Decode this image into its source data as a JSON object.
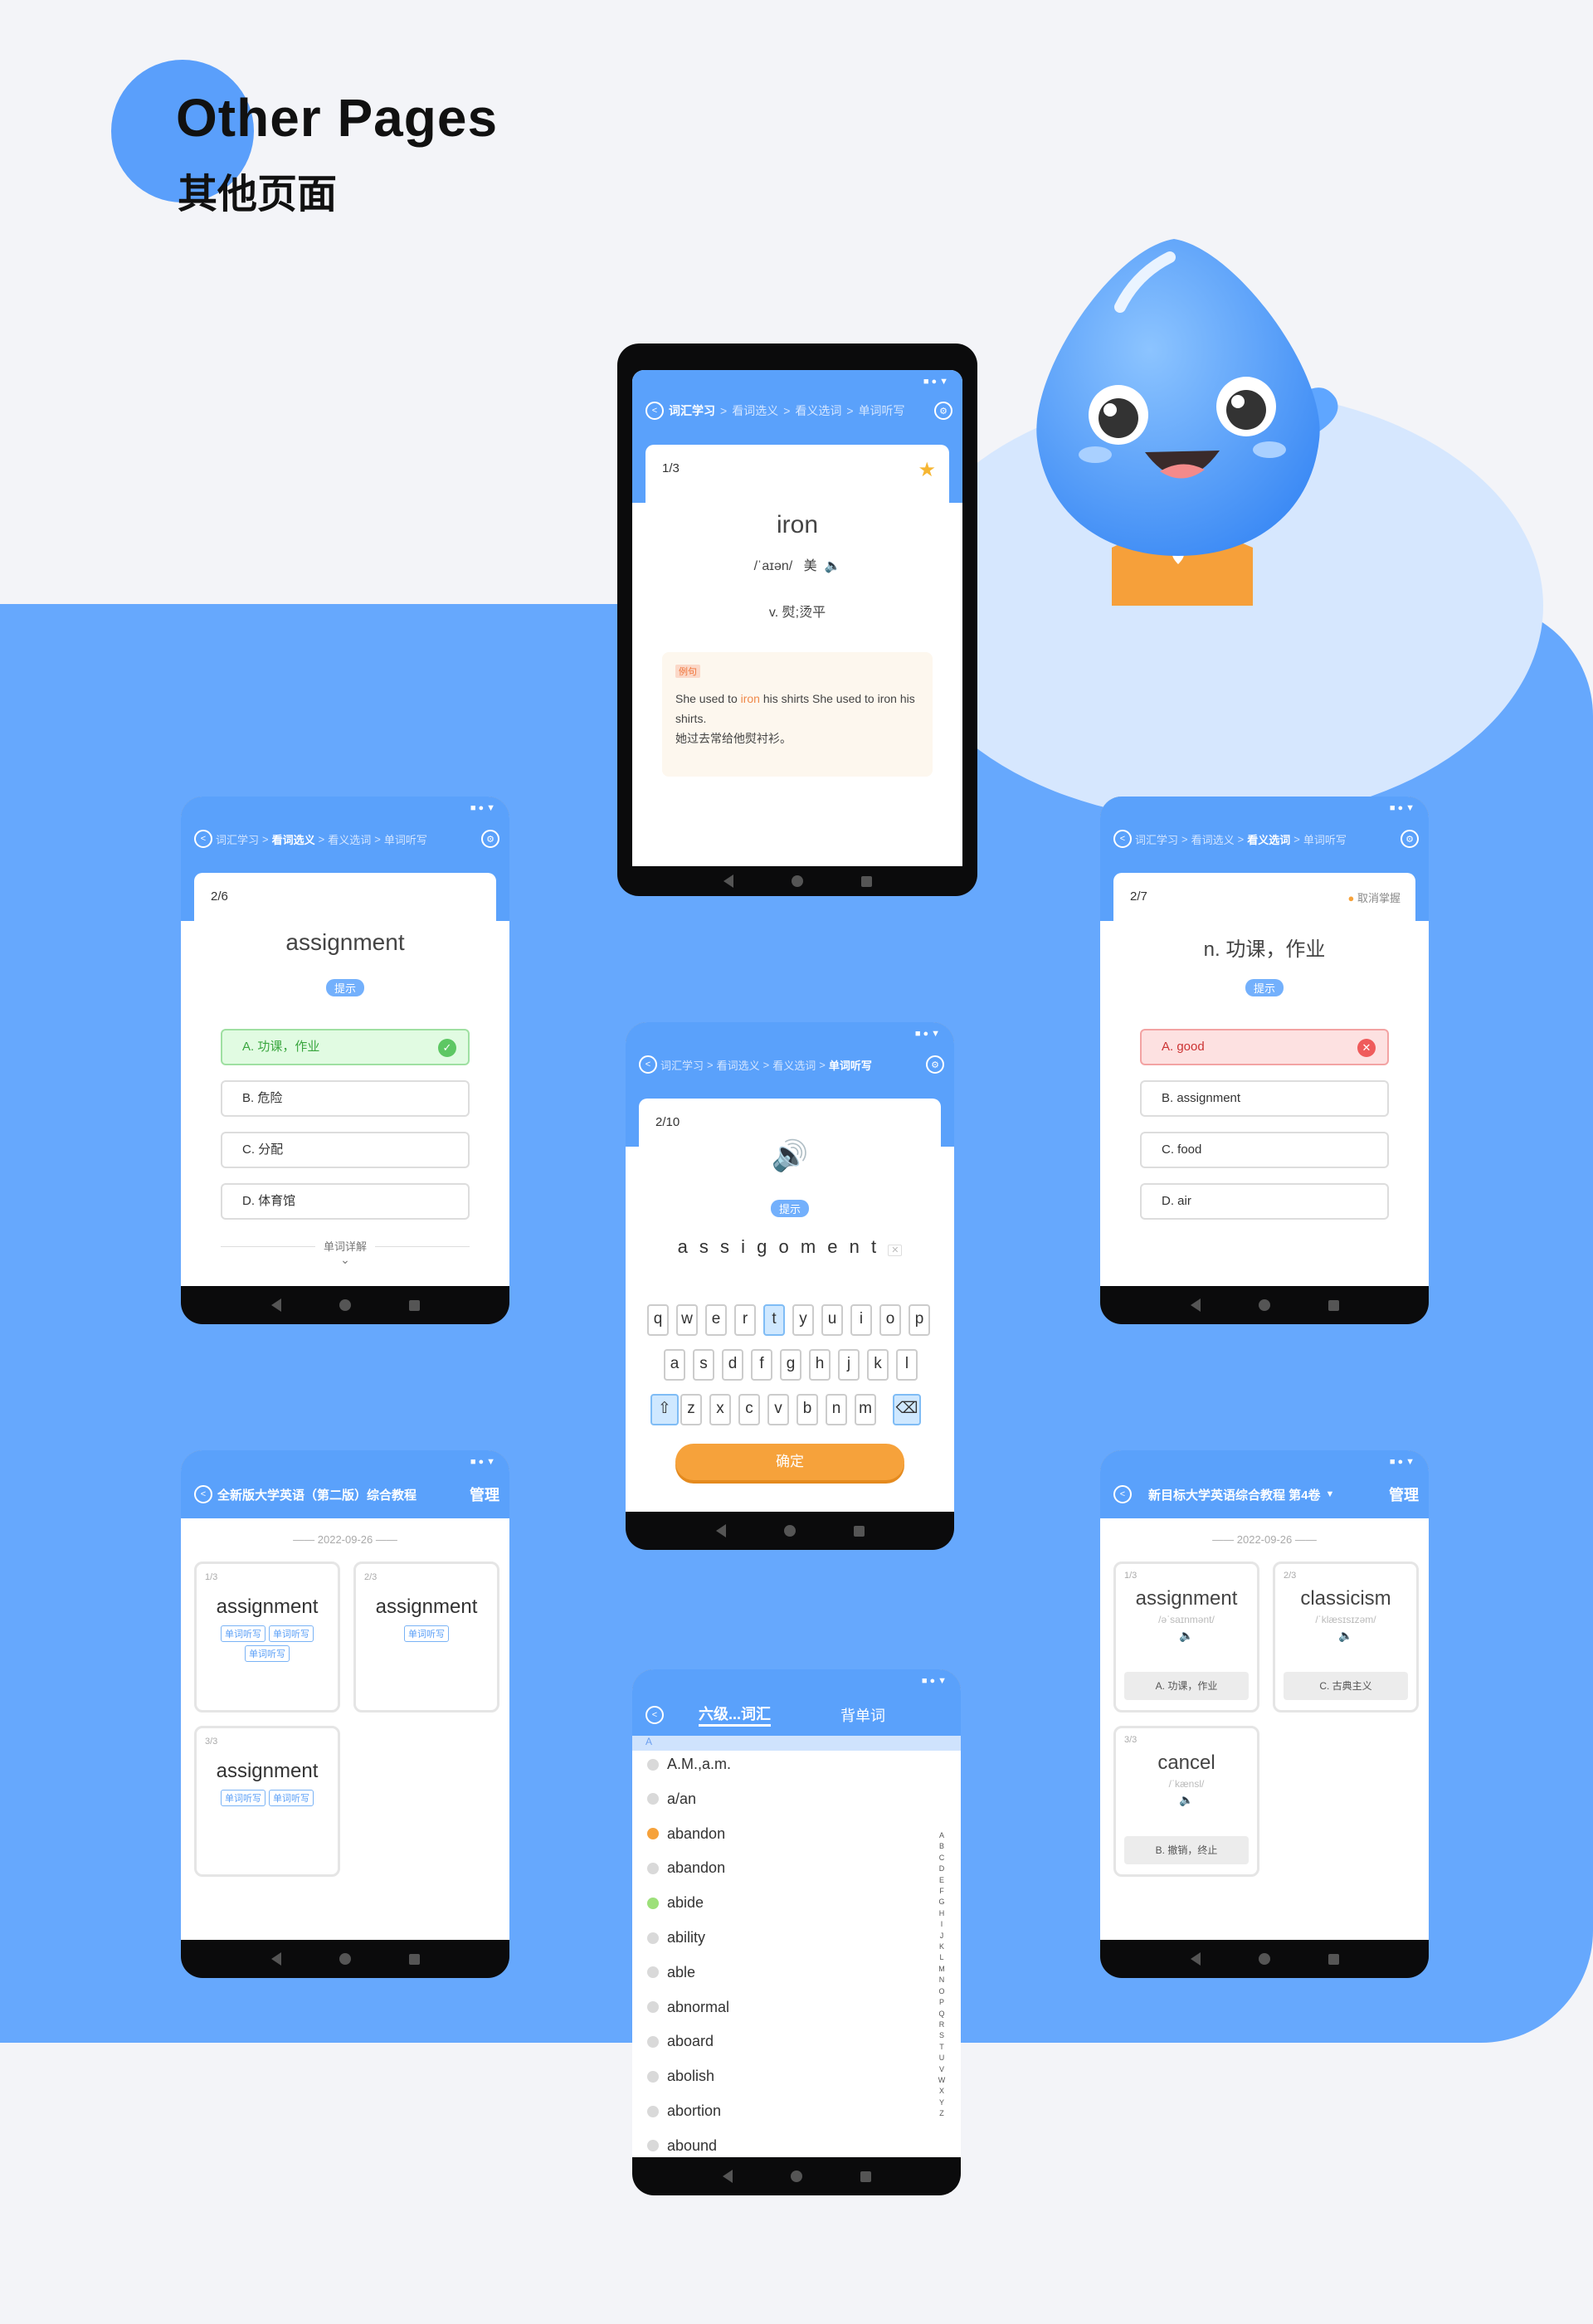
{
  "header": {
    "title_en": "Other Pages",
    "title_cn": "其他页面"
  },
  "status_icons": "■●▼",
  "colors": {
    "primary": "#5aa1fb",
    "panel": "#66a8fd",
    "orange": "#f6a23b",
    "correct": "#5dc763",
    "wrong": "#ef5b5b"
  },
  "p1": {
    "crumbs": [
      "词汇学习",
      "看词选义",
      "看义选词",
      "单词听写"
    ],
    "active": 0,
    "counter": "1/3",
    "word": "iron",
    "phonetic": "/ˈaɪən/",
    "accent": "美",
    "meaning": "v. 熨;烫平",
    "example_label": "例句",
    "example_pre": "She used to ",
    "example_hl": "iron",
    "example_post": " his shirts She used to iron his shirts.",
    "example_cn": "她过去常给他熨衬衫。"
  },
  "p2": {
    "crumbs": [
      "词汇学习",
      "看词选义",
      "看义选词",
      "单词听写"
    ],
    "counter": "2/6",
    "word": "assignment",
    "hint": "提示",
    "options": [
      "A. 功课，作业",
      "B. 危险",
      "C. 分配",
      "D. 体育馆"
    ],
    "detail": "单词详解"
  },
  "p3": {
    "crumbs": [
      "词汇学习",
      "看词选义",
      "看义选词",
      "单词听写"
    ],
    "counter": "2/7",
    "unmaster": "取消掌握",
    "word": "n. 功课，作业",
    "hint": "提示",
    "options": [
      "A. good",
      "B. assignment",
      "C. food",
      "D. air"
    ]
  },
  "p4": {
    "crumbs": [
      "词汇学习",
      "看词选义",
      "看义选词",
      "单词听写"
    ],
    "counter": "2/10",
    "hint": "提示",
    "letters": "a s s i g o m e n t",
    "keys_row1": [
      "q",
      "w",
      "e",
      "r",
      "t",
      "y",
      "u",
      "i",
      "o",
      "p"
    ],
    "keys_row2": [
      "a",
      "s",
      "d",
      "f",
      "g",
      "h",
      "j",
      "k",
      "l"
    ],
    "keys_row3": [
      "z",
      "x",
      "c",
      "v",
      "b",
      "n",
      "m"
    ],
    "confirm": "确定"
  },
  "p5": {
    "title": "全新版大学英语（第二版）综合教程",
    "manage": "管理",
    "date": "2022-09-26",
    "cards": [
      {
        "count": "1/3",
        "word": "assignment",
        "tags": [
          "单词听写",
          "单词听写",
          "单词听写"
        ]
      },
      {
        "count": "2/3",
        "word": "assignment",
        "tags": [
          "单词听写"
        ]
      },
      {
        "count": "3/3",
        "word": "assignment",
        "tags": [
          "单词听写",
          "单词听写"
        ]
      }
    ]
  },
  "p6": {
    "title": "新目标大学英语综合教程 第4卷",
    "manage": "管理",
    "date": "2022-09-26",
    "cards": [
      {
        "count": "1/3",
        "word": "assignment",
        "phon": "/əˈsaɪnmənt/",
        "meaning": "A. 功课，作业"
      },
      {
        "count": "2/3",
        "word": "classicism",
        "phon": "/ˈklæsɪsɪzəm/",
        "meaning": "C. 古典主义"
      },
      {
        "count": "3/3",
        "word": "cancel",
        "phon": "/ˈkænsl/",
        "meaning": "B. 撤销，终止"
      }
    ]
  },
  "p7": {
    "tab1": "六级...词汇",
    "tab2": "背单词",
    "section": "A",
    "words": [
      "A.M.,a.m.",
      "a/an",
      "abandon",
      "abandon",
      "abide",
      "ability",
      "able",
      "abnormal",
      "aboard",
      "abolish",
      "abortion",
      "abound"
    ],
    "alphabet": "ABCDEFGHIJKLMNOPQRSTUVWXYZ"
  }
}
